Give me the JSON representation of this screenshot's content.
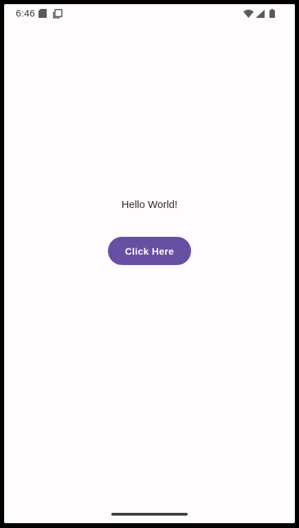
{
  "status_bar": {
    "time": "6:46",
    "left_icons": [
      "sd-card-icon",
      "screenshot-icon"
    ],
    "right_icons": [
      "wifi-icon",
      "cell-signal-icon",
      "battery-icon"
    ]
  },
  "main": {
    "hello_text": "Hello World!",
    "button_label": "Click Here"
  },
  "colors": {
    "background": "#fffbfe",
    "button": "#6750a4",
    "button_text": "#ffffff",
    "text": "#2a2a2a"
  }
}
